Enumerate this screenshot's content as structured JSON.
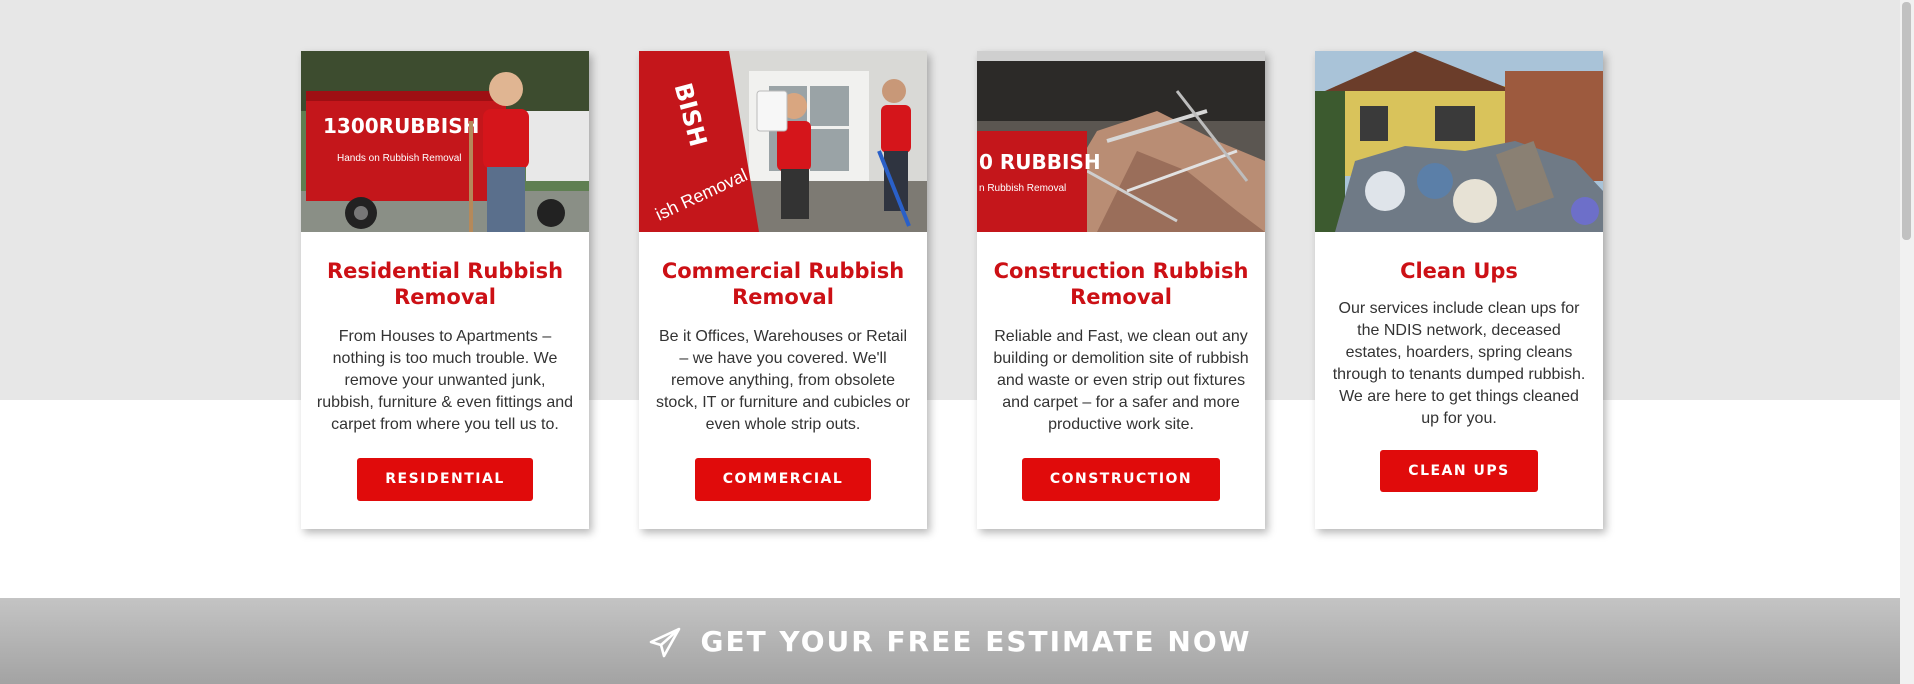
{
  "cards": [
    {
      "image_name": "residential-photo",
      "image_text": {
        "logo": "1300RUBBISH",
        "tagline": "Hands on Rubbish Removal"
      },
      "title": "Residential Rubbish Removal",
      "description": "From Houses to Apartments – nothing is too much trouble. We remove your unwanted junk, rubbish, furniture & even fittings and carpet from where you tell us to.",
      "button_label": "RESIDENTIAL"
    },
    {
      "image_name": "commercial-photo",
      "image_text": {
        "logo": "BISH",
        "tagline": "ish Removal"
      },
      "title": "Commercial Rubbish Removal",
      "description": "Be it Offices, Warehouses or Retail – we have you covered. We'll remove anything, from obsolete stock, IT or furniture and cubicles or even whole strip outs.",
      "button_label": "COMMERCIAL"
    },
    {
      "image_name": "construction-photo",
      "image_text": {
        "logo": "0 RUBBISH",
        "tagline": "n Rubbish Removal"
      },
      "title": "Construction Rubbish Removal",
      "description": "Reliable and Fast, we clean out any building or demolition site of rubbish and waste or even strip out fixtures and carpet – for a safer and more productive work site.",
      "button_label": "CONSTRUCTION"
    },
    {
      "image_name": "clean-ups-photo",
      "title": "Clean Ups",
      "description": "Our services include clean ups for the NDIS network, deceased estates, hoarders, spring cleans through to tenants dumped rubbish. We are here to get things cleaned up for you.",
      "button_label": "CLEAN UPS"
    }
  ],
  "cta": {
    "icon": "paper-plane-icon",
    "label": "GET YOUR FREE ESTIMATE NOW"
  },
  "colors": {
    "accent_red": "#e00b0b",
    "title_red": "#cc1015",
    "band_gray": "#e7e7e7",
    "cta_gray": "#b3b3b3"
  }
}
